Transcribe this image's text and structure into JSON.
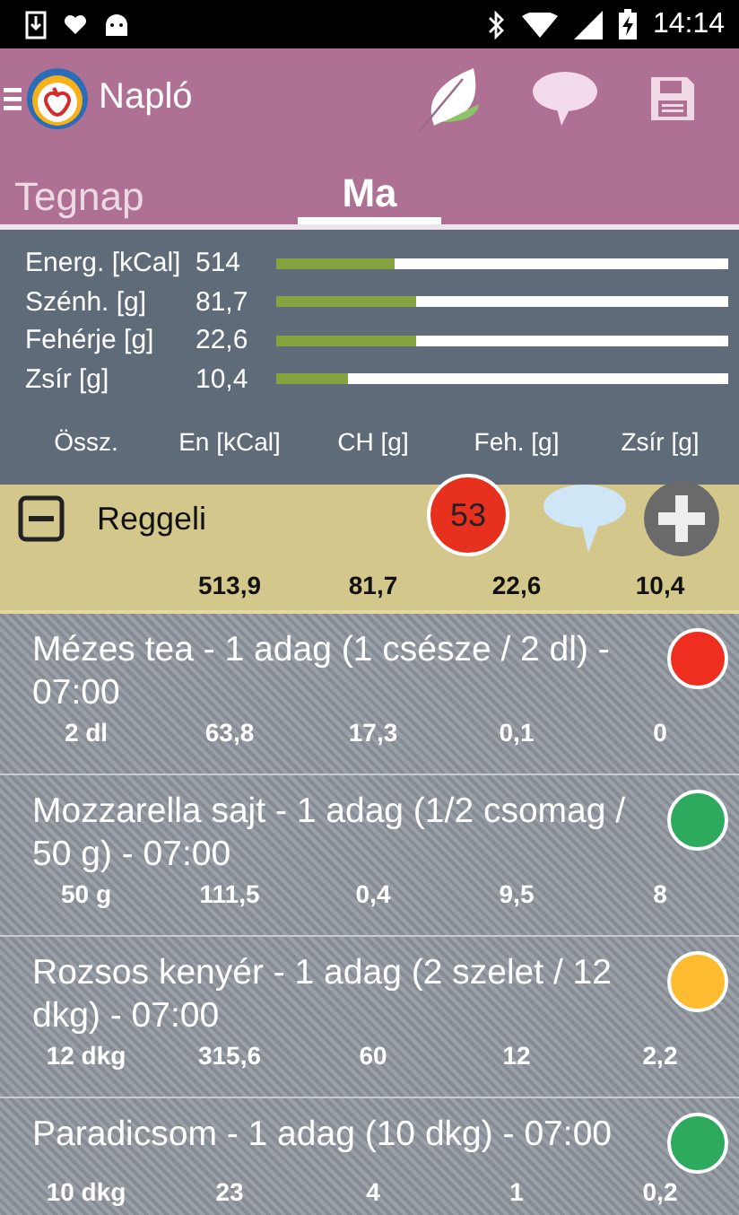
{
  "status_bar": {
    "time": "14:14"
  },
  "app_bar": {
    "title": "Napló"
  },
  "tabs": [
    {
      "label": "Tegnap",
      "selected": false
    },
    {
      "label": "Ma",
      "selected": true
    }
  ],
  "summary": {
    "rows": [
      {
        "label": "Energ. [kCal]",
        "value": "514",
        "level": 0.26
      },
      {
        "label": "Szénh. [g]",
        "value": "81,7",
        "level": 0.31
      },
      {
        "label": "Fehérje [g]",
        "value": "22,6",
        "level": 0.31
      },
      {
        "label": "Zsír [g]",
        "value": "10,4",
        "level": 0.16
      }
    ],
    "columns": [
      "Össz.",
      "En [kCal]",
      "CH [g]",
      "Feh. [g]",
      "Zsír [g]"
    ]
  },
  "meal": {
    "name": "Reggeli",
    "expanded": true,
    "badge": "53",
    "totals": [
      "513,9",
      "81,7",
      "22,6",
      "10,4"
    ]
  },
  "items": [
    {
      "title": "Mézes tea - 1 adag (1 csésze / 2 dl) - 07:00",
      "color": "#ee2e1e",
      "values": [
        "2 dl",
        "63,8",
        "17,3",
        "0,1",
        "0"
      ]
    },
    {
      "title": "Mozzarella sajt - 1 adag (1/2 csomag / 50 g) - 07:00",
      "color": "#2eaa5e",
      "values": [
        "50 g",
        "111,5",
        "0,4",
        "9,5",
        "8"
      ]
    },
    {
      "title": "Rozsos kenyér - 1 adag (2 szelet / 12 dkg) - 07:00",
      "color": "#fdbb30",
      "values": [
        "12 dkg",
        "315,6",
        "60",
        "12",
        "2,2"
      ]
    },
    {
      "title": "Paradicsom - 1 adag (10 dkg) - 07:00",
      "color": "#2eaa5e",
      "values": [
        "10 dkg",
        "23",
        "4",
        "1",
        "0,2"
      ]
    }
  ]
}
